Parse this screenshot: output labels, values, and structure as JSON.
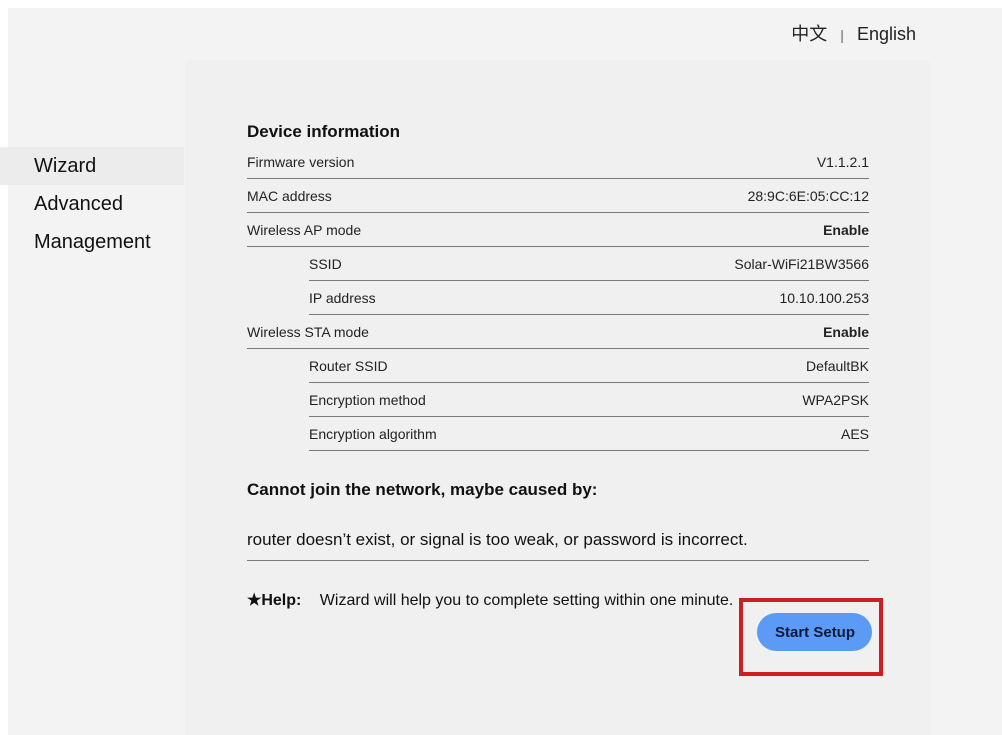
{
  "language": {
    "chinese": "中文",
    "separator": "|",
    "english": "English"
  },
  "sidebar": {
    "items": [
      {
        "label": "Wizard"
      },
      {
        "label": "Advanced"
      },
      {
        "label": "Management"
      }
    ]
  },
  "device_info": {
    "title": "Device information",
    "rows": [
      {
        "label": "Firmware version",
        "value": "V1.1.2.1"
      },
      {
        "label": "MAC address",
        "value": "28:9C:6E:05:CC:12"
      },
      {
        "label": "Wireless AP mode",
        "value": "Enable"
      },
      {
        "label": "SSID",
        "value": "Solar-WiFi21BW3566"
      },
      {
        "label": "IP address",
        "value": "10.10.100.253"
      },
      {
        "label": "Wireless STA mode",
        "value": "Enable"
      },
      {
        "label": "Router SSID",
        "value": "DefaultBK"
      },
      {
        "label": "Encryption method",
        "value": "WPA2PSK"
      },
      {
        "label": "Encryption algorithm",
        "value": "AES"
      }
    ]
  },
  "warning": {
    "title": "Cannot join the network,  maybe caused by:",
    "text": "router doesn’t exist,  or signal is too weak,  or password is incorrect."
  },
  "help": {
    "label": "★Help:",
    "text": "Wizard will help you to complete setting within one minute."
  },
  "actions": {
    "start_setup": "Start Setup"
  },
  "colors": {
    "button": "#5b9bf5",
    "highlight": "#cc1f1f",
    "panel": "#f0f0f0"
  }
}
